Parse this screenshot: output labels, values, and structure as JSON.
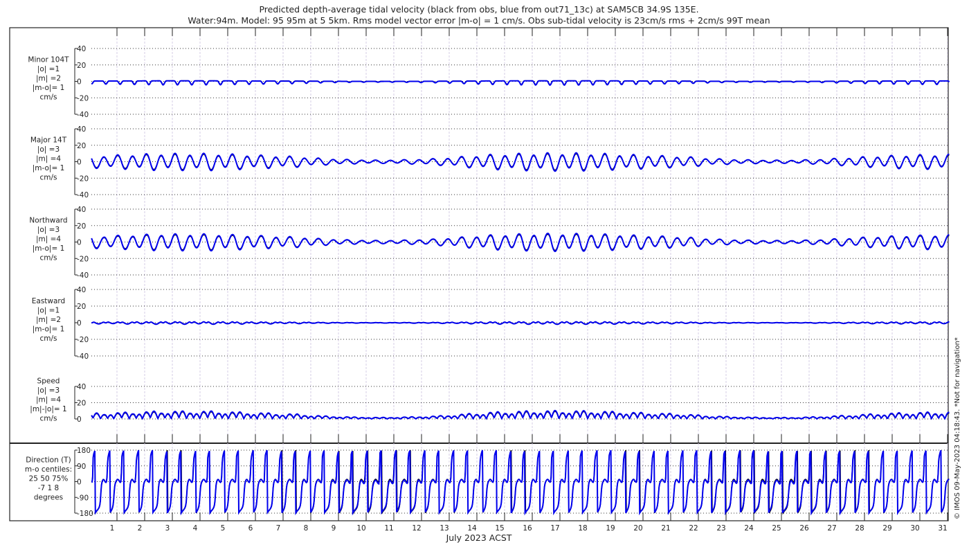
{
  "chart_data": {
    "type": "line",
    "title_line1": "Predicted depth-average tidal velocity (black from obs, blue from out71_13c) at SAM5CB 34.9S 135E.",
    "title_line2": "Water:94m. Model: 95 95m at 5 5km. Rms model vector error |m-o| = 1 cm/s. Obs sub-tidal velocity is 23cm/s rms + 2cm/s 99T mean",
    "xlabel": "July 2023 ACST",
    "xlim": [
      0,
      31.1
    ],
    "x_ticks": [
      "1",
      "2",
      "3",
      "4",
      "5",
      "6",
      "7",
      "8",
      "9",
      "10",
      "11",
      "12",
      "13",
      "14",
      "15",
      "16",
      "17",
      "18",
      "19",
      "20",
      "21",
      "22",
      "23",
      "24",
      "25",
      "26",
      "27",
      "28",
      "29",
      "30",
      "31"
    ],
    "watermark": "© IMOS 09-May-2023 04:18:43. *Not for navigation*",
    "series_legend": {
      "obs": {
        "label": "obs",
        "color": "#000000"
      },
      "model": {
        "label": "out71_13c",
        "color": "#0000ee"
      }
    },
    "daily_tidal_amplitude_cm_s": [
      6,
      7,
      8,
      8,
      8,
      7,
      6,
      5,
      3,
      2,
      1.5,
      2,
      3,
      5,
      7,
      8,
      8.5,
      8.5,
      8,
      7,
      6,
      5,
      3,
      2,
      1.5,
      1.5,
      2.5,
      4,
      5.5,
      6.5,
      7
    ],
    "panels": [
      {
        "id": "minor",
        "label": [
          "Minor 104T",
          "|o| =1",
          "|m| =2",
          "|m-o|= 1",
          "cm/s"
        ],
        "ylim": [
          -40,
          40
        ],
        "yticks": [
          "40",
          "20",
          "0",
          "-20",
          "-40"
        ],
        "ytick_values": [
          40,
          20,
          0,
          -20,
          -40
        ]
      },
      {
        "id": "major",
        "label": [
          "Major 14T",
          "|o| =3",
          "|m| =4",
          "|m-o|= 1",
          "cm/s"
        ],
        "ylim": [
          -40,
          40
        ],
        "yticks": [
          "40",
          "20",
          "0",
          "-20",
          "-40"
        ],
        "ytick_values": [
          40,
          20,
          0,
          -20,
          -40
        ]
      },
      {
        "id": "north",
        "label": [
          "Northward",
          "|o| =3",
          "|m| =4",
          "|m-o|= 1",
          "cm/s"
        ],
        "ylim": [
          -40,
          40
        ],
        "yticks": [
          "40",
          "20",
          "0",
          "-20",
          "-40"
        ],
        "ytick_values": [
          40,
          20,
          0,
          -20,
          -40
        ]
      },
      {
        "id": "east",
        "label": [
          "Eastward",
          "|o| =1",
          "|m| =2",
          "|m-o|= 1",
          "cm/s"
        ],
        "ylim": [
          -40,
          40
        ],
        "yticks": [
          "40",
          "20",
          "0",
          "-20",
          "-40"
        ],
        "ytick_values": [
          40,
          20,
          0,
          -20,
          -40
        ]
      },
      {
        "id": "speed",
        "label": [
          "Speed",
          "|o| =3",
          "|m| =4",
          "|m|-|o|= 1",
          "cm/s"
        ],
        "ylim": [
          0,
          40
        ],
        "yticks": [
          "40",
          "20",
          "0"
        ],
        "ytick_values": [
          40,
          20,
          0
        ]
      },
      {
        "id": "direction",
        "label": [
          "Direction (T)",
          "m-o centiles:",
          "25  50  75%",
          "-7  1  8",
          "degrees"
        ],
        "ylim": [
          -180,
          180
        ],
        "yticks": [
          "180",
          "90",
          "0",
          "-90",
          "-180"
        ],
        "ytick_values": [
          180,
          90,
          0,
          -90,
          -180
        ]
      }
    ]
  }
}
